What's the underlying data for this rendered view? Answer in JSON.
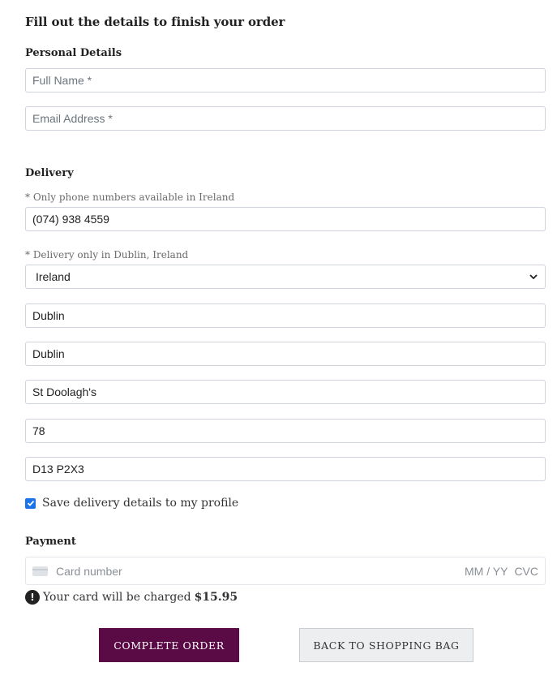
{
  "page": {
    "heading": "Fill out the details to finish your order"
  },
  "personal": {
    "title": "Personal Details",
    "full_name": {
      "placeholder": "Full Name *",
      "value": ""
    },
    "email": {
      "placeholder": "Email Address *",
      "value": ""
    }
  },
  "delivery": {
    "title": "Delivery",
    "phone_note": "* Only phone numbers available in Ireland",
    "phone": "(074) 938 4559",
    "country_note": "* Delivery only in Dublin, Ireland",
    "country": "Ireland",
    "county": "Dublin",
    "city": "Dublin",
    "street": "St Doolagh's",
    "house_number": "78",
    "postcode": "D13 P2X3",
    "save_checkbox": {
      "checked": true,
      "label": "Save delivery details to my profile"
    }
  },
  "payment": {
    "title": "Payment",
    "card_placeholder": "Card number",
    "expiry_placeholder": "MM / YY",
    "cvc_placeholder": "CVC",
    "charge_text": "Your card will be charged",
    "amount": "$15.95"
  },
  "actions": {
    "complete_label": "Complete Order",
    "back_label": "Back to Shopping Bag"
  },
  "colors": {
    "primary_button": "#5a0a45",
    "checkbox": "#1a73e8",
    "secondary_button": "#eceef0"
  },
  "icons": {
    "select_arrow": "chevron-down-icon",
    "card": "credit-card-icon",
    "alert": "exclamation-circle-icon",
    "check": "checkmark-icon"
  }
}
